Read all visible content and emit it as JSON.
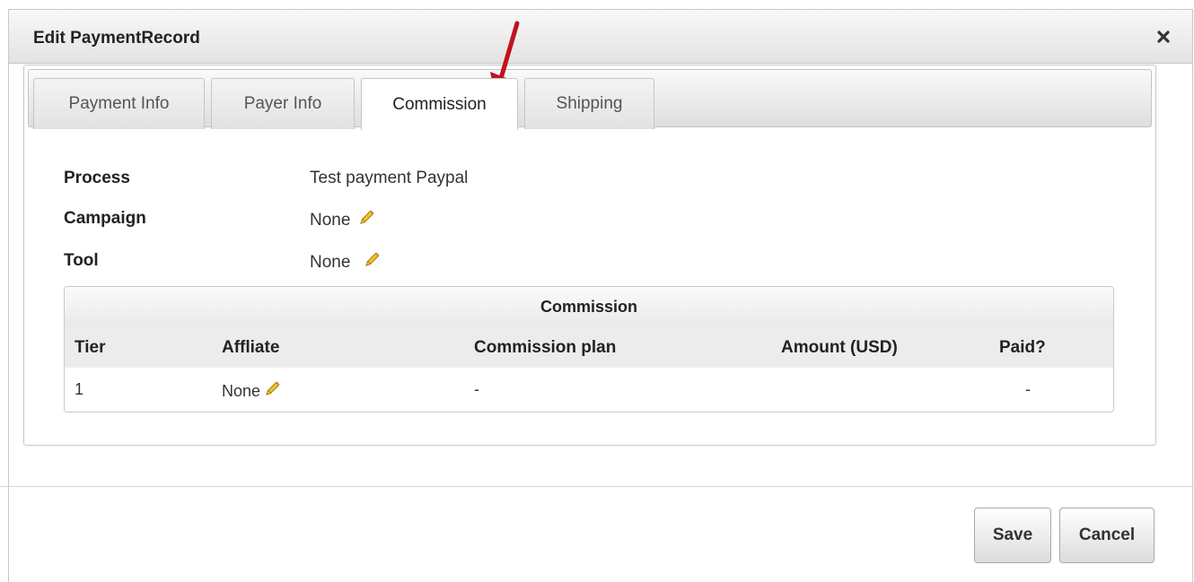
{
  "dialog": {
    "title": "Edit PaymentRecord",
    "close_symbol": "✖"
  },
  "tabs": [
    {
      "label": "Payment Info",
      "active": false
    },
    {
      "label": "Payer Info",
      "active": false
    },
    {
      "label": "Commission",
      "active": true
    },
    {
      "label": "Shipping",
      "active": false
    }
  ],
  "fields": {
    "process": {
      "label": "Process",
      "value": "Test payment Paypal"
    },
    "campaign": {
      "label": "Campaign",
      "value": "None",
      "icon": "pencil-icon"
    },
    "tool": {
      "label": "Tool",
      "value": "None",
      "icon": "pencil-icon"
    }
  },
  "commission_table": {
    "caption": "Commission",
    "columns": [
      "Tier",
      "Affliate",
      "Commission plan",
      "Amount (USD)",
      "Paid?"
    ],
    "rows": [
      {
        "tier": "1",
        "affiliate": "None",
        "plan": "-",
        "amount": "",
        "paid": "-"
      }
    ]
  },
  "footer": {
    "save_label": "Save",
    "cancel_label": "Cancel"
  },
  "annotation": {
    "icon": "red-arrow-icon",
    "color": "#c0141c"
  },
  "colors": {
    "pencil": "#e8b400",
    "arrow": "#c0141c"
  }
}
